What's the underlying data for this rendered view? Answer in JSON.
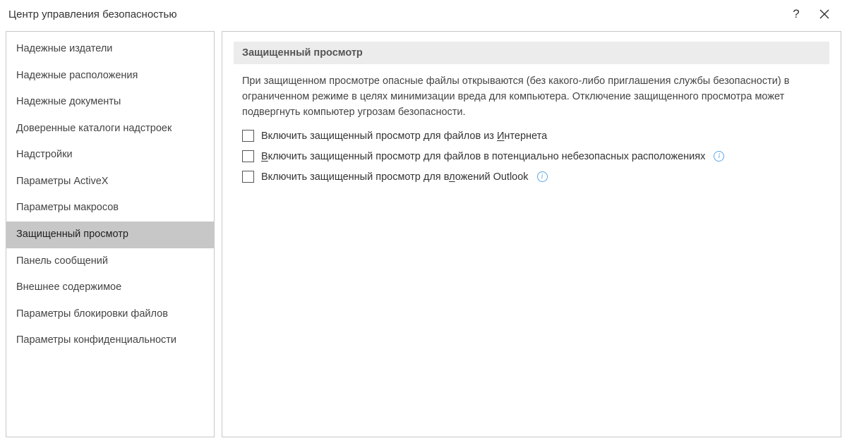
{
  "title": "Центр управления безопасностью",
  "titlebar": {
    "help_glyph": "?",
    "close_glyph": "✕"
  },
  "sidebar": {
    "items": [
      {
        "label": "Надежные издатели"
      },
      {
        "label": "Надежные расположения"
      },
      {
        "label": "Надежные документы"
      },
      {
        "label": "Доверенные каталоги надстроек"
      },
      {
        "label": "Надстройки"
      },
      {
        "label": "Параметры ActiveX"
      },
      {
        "label": "Параметры макросов"
      },
      {
        "label": "Защищенный просмотр",
        "selected": true
      },
      {
        "label": "Панель сообщений"
      },
      {
        "label": "Внешнее содержимое"
      },
      {
        "label": "Параметры блокировки файлов"
      },
      {
        "label": "Параметры конфиденциальности"
      }
    ]
  },
  "content": {
    "heading": "Защищенный просмотр",
    "description": "При защищенном просмотре опасные файлы открываются (без какого-либо приглашения службы безопасности) в ограниченном режиме в целях минимизации вреда для компьютера. Отключение защищенного просмотра может подвергнуть компьютер угрозам безопасности.",
    "options": [
      {
        "pre": "Включить защищенный просмотр для файлов из ",
        "mn": "И",
        "post": "нтернета",
        "checked": false,
        "info": false
      },
      {
        "pre": "",
        "mn": "В",
        "post": "ключить защищенный просмотр для файлов в потенциально небезопасных расположениях",
        "checked": false,
        "info": true
      },
      {
        "pre": "Включить защищенный просмотр для в",
        "mn": "л",
        "post": "ожений Outlook",
        "checked": false,
        "info": true
      }
    ],
    "info_glyph": "i"
  }
}
